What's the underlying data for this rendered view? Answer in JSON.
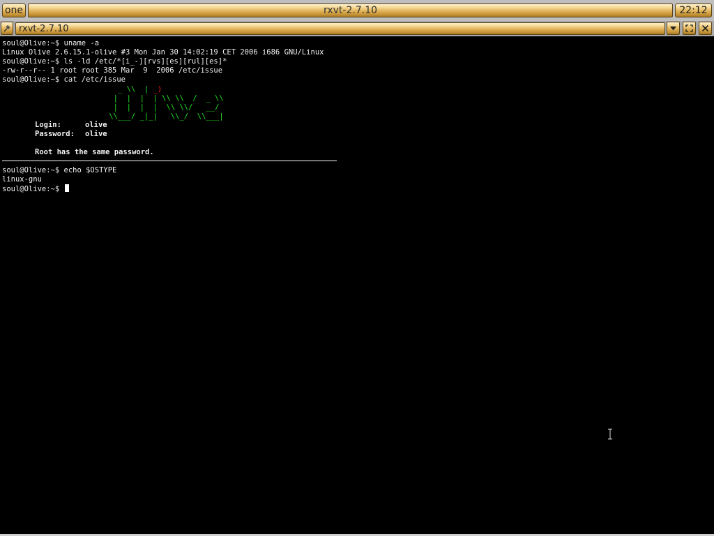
{
  "top_panel": {
    "workspace_label": "one",
    "task_title": "rxvt-2.7.10",
    "clock": "22:12"
  },
  "window": {
    "title": "rxvt-2.7.10",
    "controls": {
      "pin_icon": "pin-icon",
      "minimize_icon": "chevron-down-icon",
      "maximize_icon": "maximize-icon",
      "close_icon": "close-icon"
    }
  },
  "terminal": {
    "lines": [
      "soul@Olive:~$ uname -a",
      "Linux Olive 2.6.15.1-olive #3 Mon Jan 30 14:02:19 CET 2006 i686 GNU/Linux",
      "soul@Olive:~$ ls -ld /etc/*[i_-][rvs][es][rul][es]*",
      "-rw-r--r-- 1 root root 385 Mar  9  2006 /etc/issue",
      "soul@Olive:~$ cat /etc/issue"
    ],
    "issue": {
      "login_label": "Login:",
      "login_value": "olive",
      "password_label": "Password:",
      "password_value": "olive",
      "note": "Root has the same password."
    },
    "after_lines": [
      "soul@Olive:~$ echo $OSTYPE",
      "linux-gnu"
    ],
    "prompt": "soul@Olive:~$ "
  },
  "colors": {
    "background": "#000000",
    "text": "#f2f2f2",
    "ascii_art": "#22e022",
    "ascii_accent": "#ff2020",
    "bar_gold": "#e0b35a"
  }
}
